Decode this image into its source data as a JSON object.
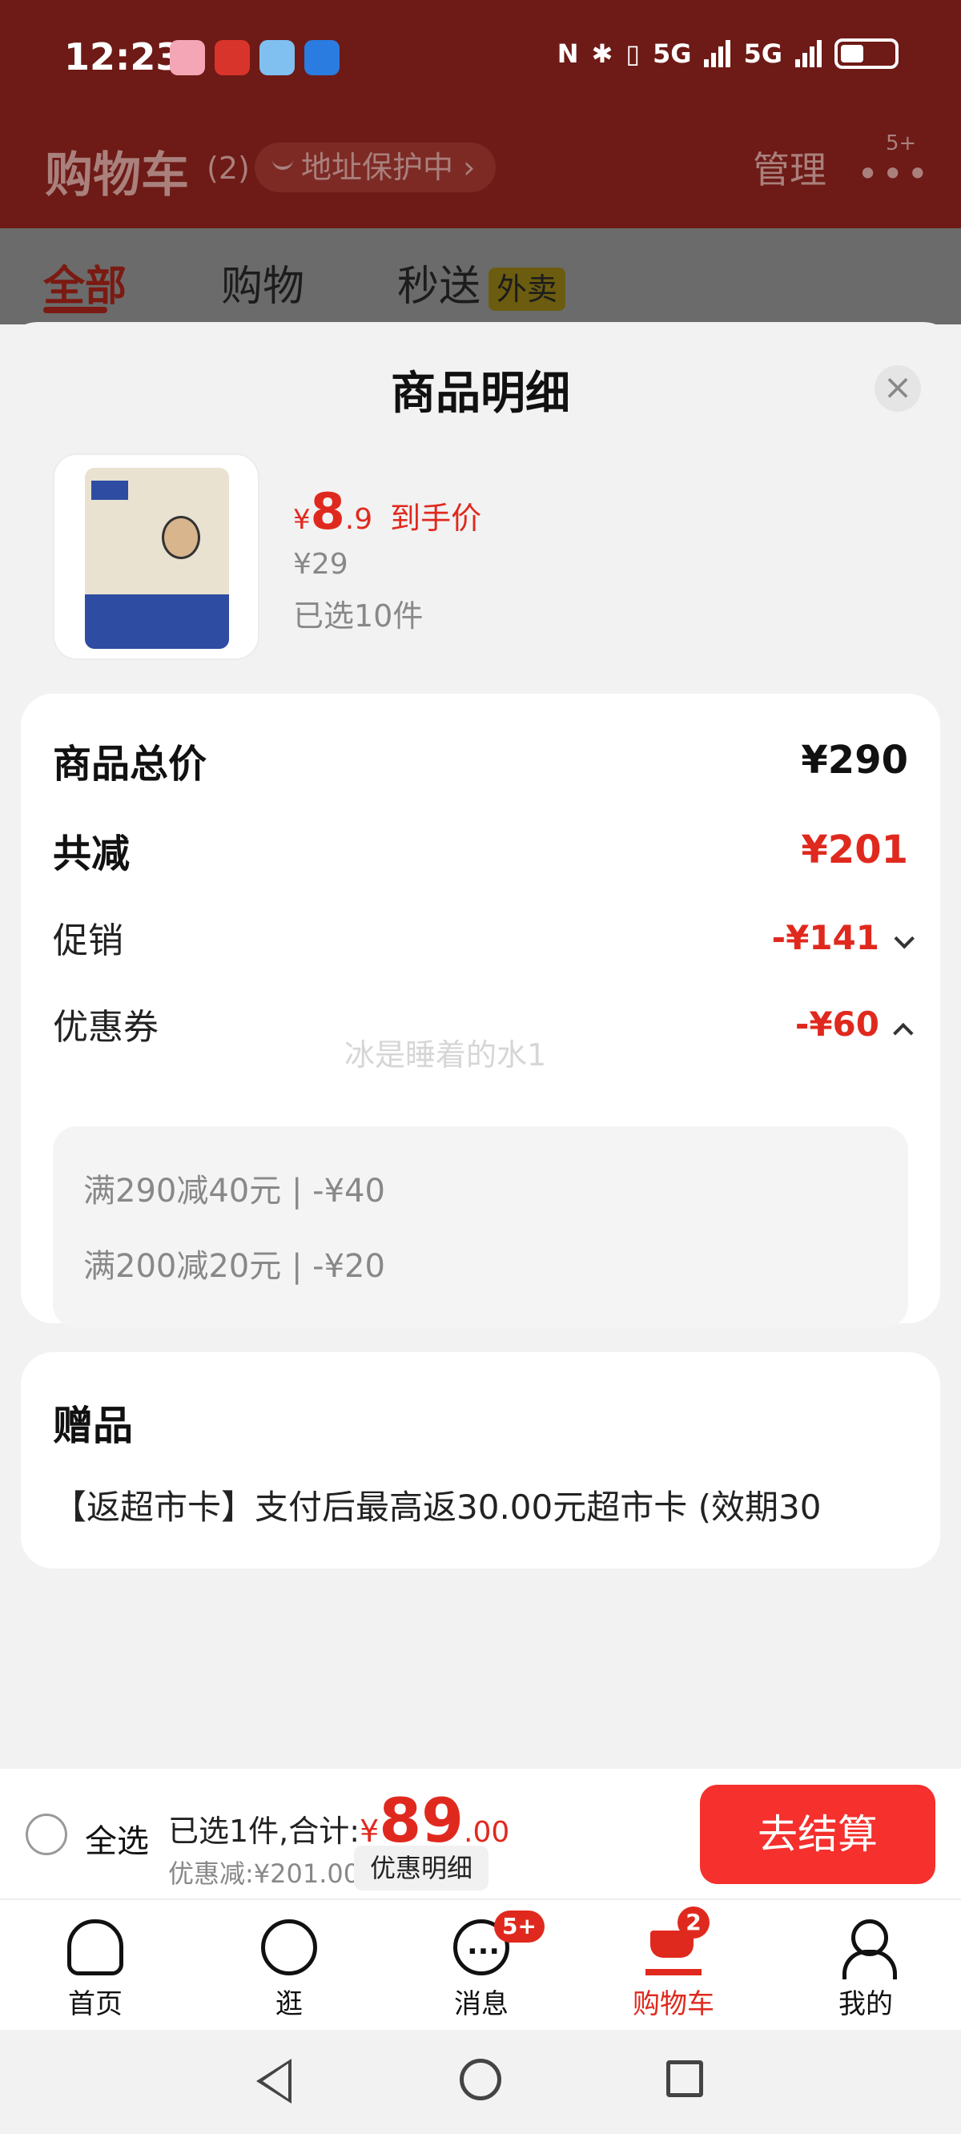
{
  "status_bar": {
    "time": "12:23",
    "network_1": "5G",
    "network_2": "5G"
  },
  "header": {
    "title": "购物车",
    "count": "(2)",
    "address_chip": "地址保护中",
    "manage": "管理",
    "more": "•••",
    "more_badge": "5+"
  },
  "tabs": [
    {
      "label": "全部",
      "active": true
    },
    {
      "label": "购物",
      "active": false
    },
    {
      "label": "秒送",
      "active": false,
      "tag": "外卖"
    }
  ],
  "sheet": {
    "title": "商品明细",
    "close": "×",
    "product": {
      "price_symbol": "¥",
      "price_int": "8",
      "price_dec": ".9",
      "price_tag": "到手价",
      "original_price": "¥29",
      "quantity": "已选10件"
    },
    "breakdown": {
      "total_label": "商品总价",
      "total_value": "¥290",
      "reduce_label": "共减",
      "reduce_value": "¥201",
      "promo_label": "促销",
      "promo_value": "-¥141",
      "coupon_label": "优惠券",
      "coupon_value": "-¥60",
      "watermark": "冰是睡着的水1",
      "coupons": [
        "满290减40元 | -¥40",
        "满200减20元 | -¥20"
      ]
    },
    "gift": {
      "title": "赠品",
      "text": "【返超市卡】支付后最高返30.00元超市卡 (效期30"
    }
  },
  "action_bar": {
    "select_all": "全选",
    "summary_prefix": "已选1件,合计:",
    "total_symbol": "¥",
    "total_int": "89",
    "total_dec": ".00",
    "discount": "优惠减:¥201.00",
    "discount_detail": "优惠明细",
    "checkout": "去结算"
  },
  "bottom_nav": [
    {
      "label": "首页",
      "icon": "home-icon",
      "active": false
    },
    {
      "label": "逛",
      "icon": "bun-icon",
      "active": false
    },
    {
      "label": "消息",
      "icon": "message-icon",
      "active": false,
      "badge": "5+"
    },
    {
      "label": "购物车",
      "icon": "cart-icon",
      "active": true,
      "badge": "2"
    },
    {
      "label": "我的",
      "icon": "profile-icon",
      "active": false
    }
  ],
  "colors": {
    "accent": "#e0291e",
    "checkout": "#f5302d",
    "header_bg": "#6e1a16"
  }
}
